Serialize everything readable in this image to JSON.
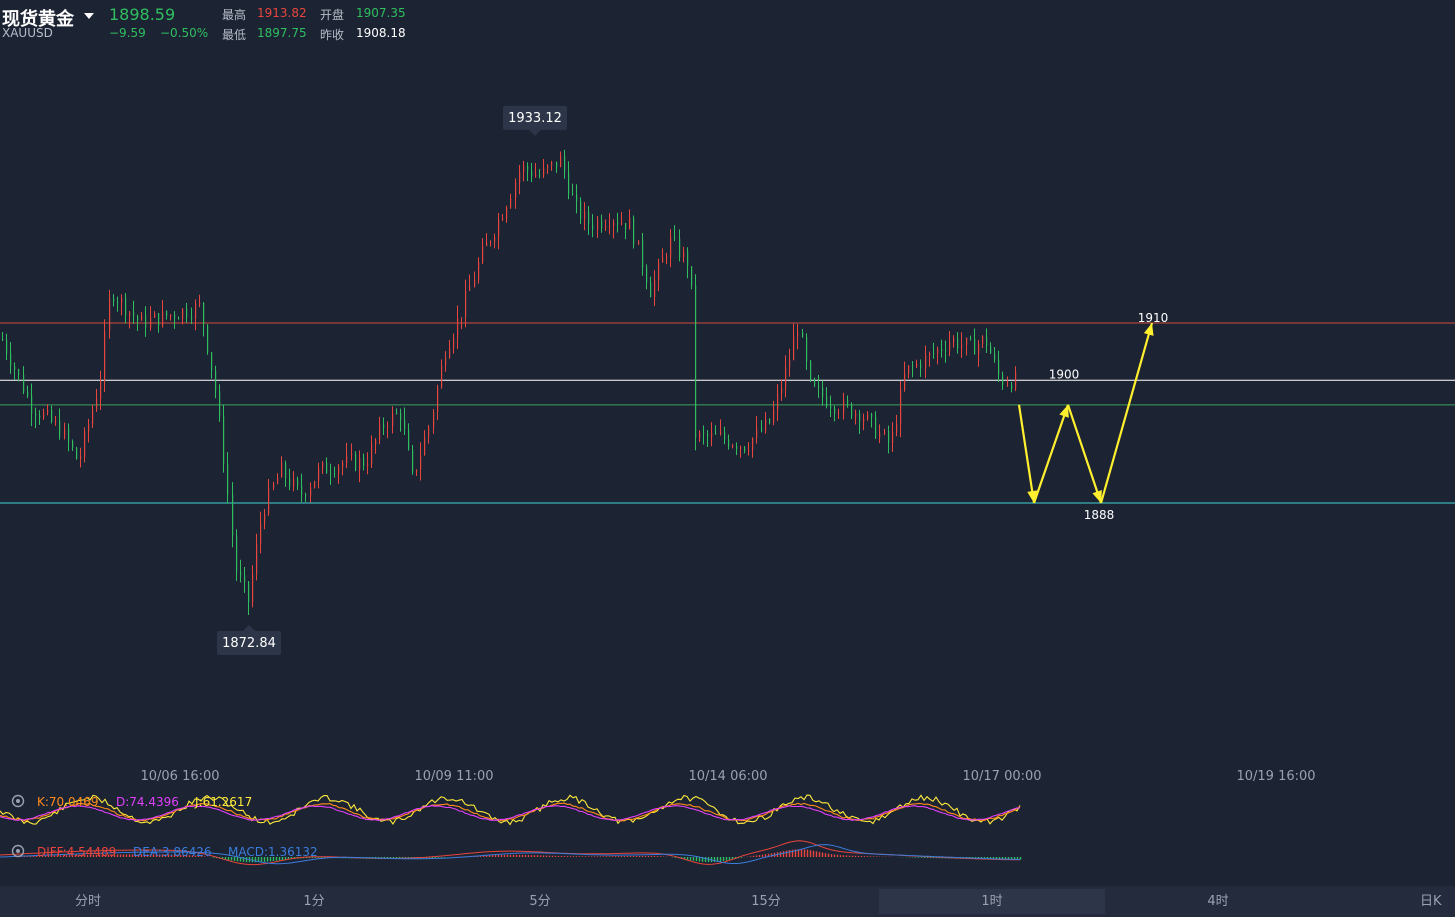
{
  "header": {
    "symbol": "现货黄金",
    "code": "XAUUSD",
    "price": "1898.59",
    "change": "−9.59",
    "change_pct": "−0.50%",
    "high_label": "最高",
    "high_value": "1913.82",
    "open_label": "开盘",
    "open_value": "1907.35",
    "low_label": "最低",
    "low_value": "1897.75",
    "prev_close_label": "昨收",
    "prev_close_value": "1908.18"
  },
  "chart_data": {
    "type": "candlestick",
    "price_range": [
      1860,
      1945
    ],
    "max_marker": "1933.12",
    "min_marker": "1872.84",
    "horizontal_levels": [
      {
        "value": 1910,
        "color": "#d14b3e"
      },
      {
        "value": 1903,
        "color": "#ffffff"
      },
      {
        "value": 1900,
        "color": "#3aa35a"
      },
      {
        "value": 1888,
        "color": "#3fd3d3"
      }
    ],
    "projection": {
      "color": "#ffef2e",
      "labels": [
        "1900",
        "1888",
        "1910"
      ]
    },
    "x_tick_labels": [
      "10/06 16:00",
      "10/09 11:00",
      "10/14 06:00",
      "10/17 00:00",
      "10/19 16:00"
    ],
    "kdj": {
      "k_label": "K:70.0469",
      "d_label": "D:74.4396",
      "j_label": "J:61.2617",
      "k_color": "#ff8c1a",
      "d_color": "#e040fb",
      "j_color": "#ffeb3b"
    },
    "macd": {
      "diff_label": "DIFF:4.54489",
      "dea_label": "DEA:3.86426",
      "macd_label": "MACD:1.36132",
      "diff_color": "#e8453c",
      "dea_color": "#3b7ddd",
      "macd_color": "#3b7ddd"
    },
    "up_color": "#e8453c",
    "down_color": "#2fbf5f"
  },
  "tabs": [
    {
      "label": "分时"
    },
    {
      "label": "1分"
    },
    {
      "label": "5分"
    },
    {
      "label": "15分"
    },
    {
      "label": "1时",
      "active": true
    },
    {
      "label": "4时"
    },
    {
      "label": "日K"
    }
  ]
}
